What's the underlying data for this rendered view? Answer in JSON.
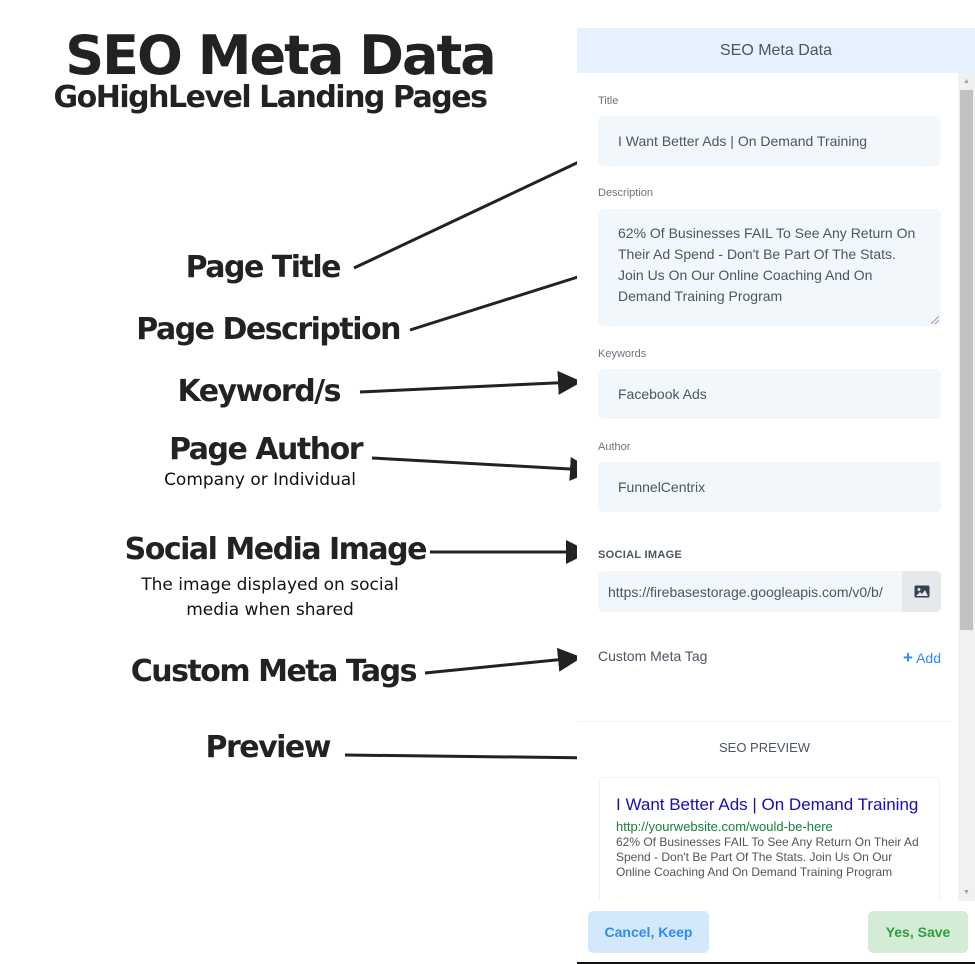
{
  "annotations": {
    "heading": "SEO Meta Data",
    "subheading": "GoHighLevel Landing Pages",
    "labels": [
      {
        "text": "Page Title",
        "note": ""
      },
      {
        "text": "Page Description",
        "note": ""
      },
      {
        "text": "Keyword/s",
        "note": ""
      },
      {
        "text": "Page Author",
        "note": "Company or Individual"
      },
      {
        "text": "Social Media Image",
        "note_line1": "The image displayed on social",
        "note_line2": "media when shared"
      },
      {
        "text": "Custom Meta Tags",
        "note": ""
      },
      {
        "text": "Preview",
        "note": ""
      }
    ]
  },
  "panel": {
    "header": "SEO Meta Data",
    "fields": {
      "title": {
        "label": "Title",
        "value": "I Want Better Ads | On Demand Training"
      },
      "description": {
        "label": "Description",
        "value": "62% Of Businesses FAIL To See Any Return On Their Ad Spend - Don't Be Part Of The Stats. Join Us On Our Online Coaching And On Demand Training Program"
      },
      "keywords": {
        "label": "Keywords",
        "value": "Facebook Ads"
      },
      "author": {
        "label": "Author",
        "value": "FunnelCentrix"
      }
    },
    "social_image": {
      "label": "SOCIAL IMAGE",
      "value": "https://firebasestorage.googleapis.com/v0/b/",
      "icon": "image-icon"
    },
    "custom_meta": {
      "label": "Custom Meta Tag",
      "add_plus": "+",
      "add_label": "Add"
    },
    "preview": {
      "section_title": "SEO PREVIEW",
      "title": "I Want Better Ads | On Demand Training",
      "url": "http://yourwebsite.com/would-be-here",
      "description": "62% Of Businesses FAIL To See Any Return On Their Ad Spend - Don't Be Part Of The Stats. Join Us On Our Online Coaching And On Demand Training Program"
    },
    "buttons": {
      "cancel": "Cancel, Keep",
      "save": "Yes, Save"
    },
    "colors": {
      "header_bg": "#e5f1fd",
      "link_blue": "#2d8cf0",
      "preview_title": "#1a0dab",
      "preview_url": "#188038",
      "save_green": "#2e9e3e"
    }
  }
}
